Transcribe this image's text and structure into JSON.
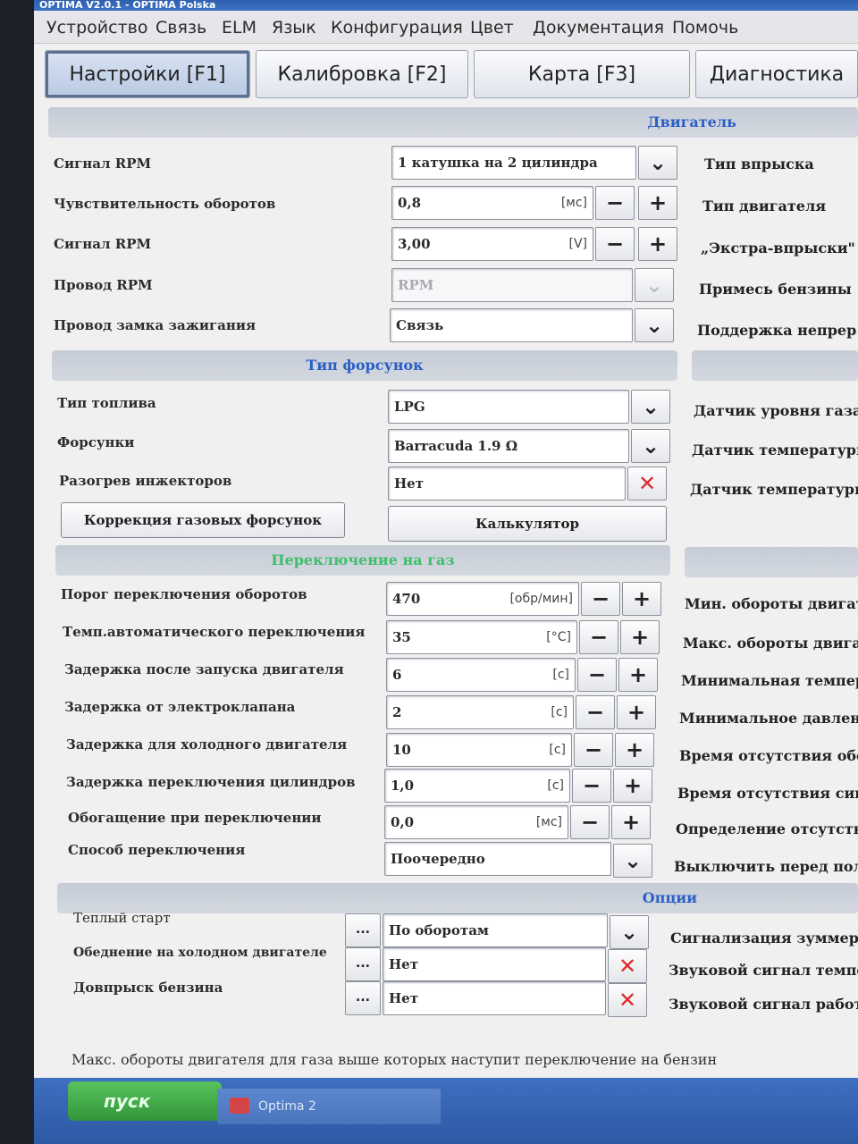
{
  "window": {
    "title": "OPTIMA V2.0.1 - OPTIMA Polska"
  },
  "menu": [
    "Устройство",
    "Связь",
    "ELM",
    "Язык",
    "Конфигурация",
    "Цвет",
    "Документация",
    "Помочь"
  ],
  "tabs": [
    "Настройки [F1]",
    "Калибровка [F2]",
    "Карта [F3]",
    "Диагностика"
  ],
  "sections": {
    "engine": "Двигатель",
    "injectors": "Тип форсунок",
    "switching": "Переключение на газ",
    "options": "Опции"
  },
  "colors": {
    "accent_blue": "#2b5fc7",
    "accent_green": "#3fbf6a",
    "close_red": "#e02a2a"
  },
  "engine_rows": [
    {
      "label": "Сигнал RPM",
      "value": "1 катушка на 2 цилиндра",
      "unit": "",
      "control": "dropdown"
    },
    {
      "label": "Чувствительность оборотов",
      "value": "0,8",
      "unit": "[мс]",
      "control": "stepper"
    },
    {
      "label": "Сигнал RPM",
      "value": "3,00",
      "unit": "[V]",
      "control": "stepper"
    },
    {
      "label": "Провод RPM",
      "value": "RPM",
      "unit": "",
      "control": "dropdown-disabled"
    },
    {
      "label": "Провод замка зажигания",
      "value": "Связь",
      "unit": "",
      "control": "dropdown"
    }
  ],
  "engine_right": [
    "Тип впрыска",
    "Тип двигателя",
    "„Экстра-впрыски\"",
    "Примесь бензины",
    "Поддержка непрер"
  ],
  "injector_rows": [
    {
      "label": "Тип топлива",
      "value": "LPG",
      "control": "dropdown"
    },
    {
      "label": "Форсунки",
      "value": "Barracuda 1.9 Ω",
      "control": "dropdown"
    },
    {
      "label": "Разогрев инжекторов",
      "value": "Нет",
      "control": "close"
    }
  ],
  "injector_right": [
    "Датчик уровня газа",
    "Датчик температуры",
    "Датчик температуры"
  ],
  "injector_buttons": {
    "correction": "Коррекция газовых форсунок",
    "calculator": "Калькулятор"
  },
  "switch_rows": [
    {
      "label": "Порог переключения оборотов",
      "value": "470",
      "unit": "[обр/мин]",
      "control": "stepper"
    },
    {
      "label": "Темп.автоматического переключения",
      "value": "35",
      "unit": "[°C]",
      "control": "stepper"
    },
    {
      "label": "Задержка после запуска двигателя",
      "value": "6",
      "unit": "[с]",
      "control": "stepper"
    },
    {
      "label": "Задержка от электроклапана",
      "value": "2",
      "unit": "[с]",
      "control": "stepper"
    },
    {
      "label": "Задержка для холодного двигателя",
      "value": "10",
      "unit": "[с]",
      "control": "stepper"
    },
    {
      "label": "Задержка переключения цилиндров",
      "value": "1,0",
      "unit": "[с]",
      "control": "stepper"
    },
    {
      "label": "Обогащение при переключении",
      "value": "0,0",
      "unit": "[мс]",
      "control": "stepper"
    },
    {
      "label": "Способ переключения",
      "value": "Поочередно",
      "unit": "",
      "control": "dropdown"
    }
  ],
  "switch_right": [
    "Мин. обороты двигат",
    "Макс. обороты двигат",
    "Минимальная темпера",
    "Минимальное давлен",
    "Время отсутствия обор",
    "Время отсутствия сигна",
    "Определение отсутстви",
    "Выключить перед полн"
  ],
  "option_rows": [
    {
      "label": "Теплый старт",
      "value": "По оборотам",
      "control": "dropdown"
    },
    {
      "label": "Обеднение на холодном двигателе",
      "value": "Нет",
      "control": "close"
    },
    {
      "label": "Довпрыск бензина",
      "value": "Нет",
      "control": "close"
    }
  ],
  "option_right": [
    "Сигнализация зуммера",
    "Звуковой сигнал темпера",
    "Звуковой сигнал работы"
  ],
  "dots_label": "...",
  "glyphs": {
    "minus": "−",
    "plus": "+",
    "chevron": "⌄",
    "close": "✕"
  },
  "status": "Макс. обороты двигателя для газа выше которых наступит переключение на бензин",
  "taskbar": {
    "start": "пуск",
    "task": "Optima 2"
  }
}
